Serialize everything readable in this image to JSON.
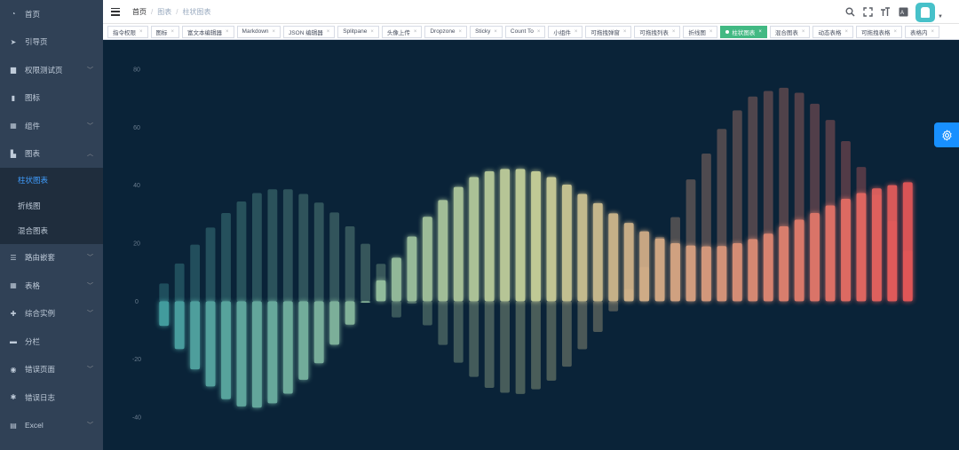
{
  "sidebar": {
    "items": [
      {
        "label": "首页",
        "icon": "dashboard-icon",
        "arrow": false
      },
      {
        "label": "引导页",
        "icon": "guide-icon",
        "arrow": false
      },
      {
        "label": "权限测试页",
        "icon": "lock-icon",
        "arrow": true
      },
      {
        "label": "图标",
        "icon": "icon-icon",
        "arrow": false
      },
      {
        "label": "组件",
        "icon": "component-icon",
        "arrow": true
      },
      {
        "label": "图表",
        "icon": "chart-icon",
        "arrow": true,
        "open": true
      }
    ],
    "submenu": [
      {
        "label": "柱状图表",
        "active": true
      },
      {
        "label": "折线图",
        "active": false
      },
      {
        "label": "混合图表",
        "active": false
      }
    ],
    "items_after": [
      {
        "label": "路由嵌套",
        "icon": "nested-icon",
        "arrow": true
      },
      {
        "label": "表格",
        "icon": "table-icon",
        "arrow": true
      },
      {
        "label": "综合实例",
        "icon": "example-icon",
        "arrow": true
      },
      {
        "label": "分栏",
        "icon": "tab-icon",
        "arrow": false
      },
      {
        "label": "错误页面",
        "icon": "404-icon",
        "arrow": true
      },
      {
        "label": "错误日志",
        "icon": "bug-icon",
        "arrow": false
      },
      {
        "label": "Excel",
        "icon": "excel-icon",
        "arrow": true
      }
    ]
  },
  "breadcrumb": [
    "首页",
    "图表",
    "柱状图表"
  ],
  "tags": [
    {
      "label": "指令权限",
      "active": false
    },
    {
      "label": "图标",
      "active": false
    },
    {
      "label": "富文本编辑器",
      "active": false
    },
    {
      "label": "Markdown",
      "active": false
    },
    {
      "label": "JSON 编辑器",
      "active": false
    },
    {
      "label": "Splitpane",
      "active": false
    },
    {
      "label": "头像上传",
      "active": false
    },
    {
      "label": "Dropzone",
      "active": false
    },
    {
      "label": "Sticky",
      "active": false
    },
    {
      "label": "Count To",
      "active": false
    },
    {
      "label": "小组件",
      "active": false
    },
    {
      "label": "可拖拽弹窗",
      "active": false
    },
    {
      "label": "可拖拽列表",
      "active": false
    },
    {
      "label": "折线图",
      "active": false
    },
    {
      "label": "柱状图表",
      "active": true
    },
    {
      "label": "混合图表",
      "active": false
    },
    {
      "label": "动态表格",
      "active": false
    },
    {
      "label": "可拖拽表格",
      "active": false
    },
    {
      "label": "表格内",
      "active": false
    }
  ],
  "header_tools": [
    "search-icon",
    "fullscreen-icon",
    "size-icon",
    "language-icon"
  ],
  "chart_data": {
    "type": "bar",
    "ylim": [
      -40,
      80
    ],
    "yticks": [
      -40,
      -20,
      0,
      20,
      40,
      60,
      80
    ],
    "ytick_labels": [
      "-40",
      "-20",
      "0",
      "20",
      "40",
      "60",
      "80"
    ],
    "grid": false,
    "legend": "none",
    "colors": {
      "start": "#4aa8a8",
      "mid": "#d4dba0",
      "end": "#f05a5a"
    },
    "series": [
      {
        "values": [
          -8.5,
          -16.5,
          -23.5,
          -29.4,
          -33.8,
          -36.3,
          -36.7,
          -35.2,
          -31.9,
          -27.1,
          -21.4,
          -15.0,
          -8.1,
          -0.5,
          7.2,
          15.0,
          22.3,
          29.1,
          34.9,
          39.4,
          42.8,
          44.8,
          45.6,
          45.6,
          44.8,
          42.8,
          40.2,
          37.0,
          33.8,
          30.3,
          27.0,
          24.1,
          21.6,
          20.0,
          19.2,
          18.9,
          19.0,
          20.0,
          21.4,
          23.3,
          25.8,
          28.1,
          30.4,
          33.0,
          35.3,
          37.3,
          38.9,
          40.0,
          41.0
        ]
      },
      {
        "values": [
          6.1,
          13.0,
          19.5,
          25.4,
          30.4,
          34.4,
          37.3,
          38.6,
          38.6,
          37.0,
          34.0,
          30.6,
          25.8,
          19.8,
          12.9,
          -5.6,
          -0.8,
          -8.3,
          -15.1,
          -21.2,
          -26.1,
          -29.9,
          -31.6,
          -32.0,
          -30.4,
          -27.4,
          -22.6,
          -16.6,
          -10.6,
          -3.5,
          4.2,
          11.8,
          22.2,
          29.0,
          42.0,
          50.9,
          59.4,
          65.8,
          70.6,
          72.5,
          73.6,
          71.9,
          68.1,
          62.5,
          55.2,
          46.3,
          36.7,
          27.6,
          17.4
        ]
      }
    ]
  }
}
